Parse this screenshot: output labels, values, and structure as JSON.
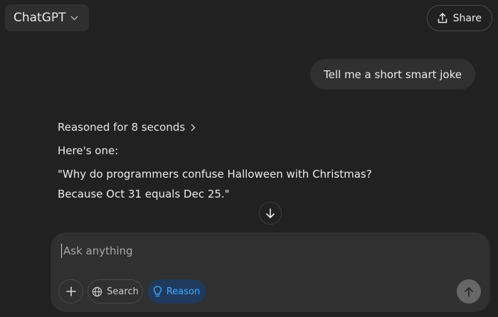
{
  "header": {
    "model_name": "ChatGPT",
    "share_label": "Share"
  },
  "conversation": {
    "user_message": "Tell me a short smart joke",
    "reasoning_label": "Reasoned for 8 seconds",
    "answer_lines": [
      "Here's one:",
      "\"Why do programmers confuse Halloween with Christmas?",
      "Because Oct 31 equals Dec 25.\""
    ]
  },
  "composer": {
    "placeholder": "Ask anything",
    "value": "",
    "search_label": "Search",
    "reason_label": "Reason"
  },
  "colors": {
    "background": "#212121",
    "surface": "#303030",
    "reason_active_bg": "#1f3a5c",
    "reason_active_text": "#48aaff",
    "send_disabled": "#676767"
  },
  "icons": {
    "model_switcher": "chevron-down-icon",
    "share": "share-upload-icon",
    "reasoning": "chevron-right-icon",
    "scroll": "arrow-down-icon",
    "attach": "plus-icon",
    "search": "globe-icon",
    "reason": "lightbulb-icon",
    "send": "arrow-up-icon"
  }
}
